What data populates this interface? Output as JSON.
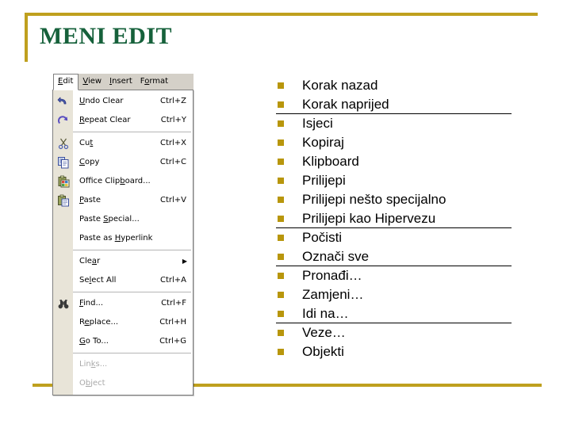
{
  "slide": {
    "title": "MENI EDIT",
    "accent_color": "#bfa01e",
    "title_color": "#16613b",
    "bullet_color": "#b8960c",
    "background_color": "#ffffff"
  },
  "menu_screenshot": {
    "menubar": [
      {
        "label": "Edit",
        "accel_letter": "E",
        "active": true
      },
      {
        "label": "View",
        "accel_letter": "V",
        "active": false
      },
      {
        "label": "Insert",
        "accel_letter": "I",
        "active": false
      },
      {
        "label": "Format",
        "accel_letter": "o",
        "active": false
      }
    ],
    "items": [
      {
        "label": "Undo Clear",
        "accel": "Ctrl+Z",
        "icon": "undo-arrow-icon",
        "disabled": false,
        "submenu": false
      },
      {
        "label": "Repeat Clear",
        "accel": "Ctrl+Y",
        "icon": "redo-arrow-icon",
        "disabled": false,
        "submenu": false
      },
      {
        "separator": true
      },
      {
        "label": "Cut",
        "accel": "Ctrl+X",
        "icon": "scissors-icon",
        "disabled": false,
        "submenu": false
      },
      {
        "label": "Copy",
        "accel": "Ctrl+C",
        "icon": "copy-icon",
        "disabled": false,
        "submenu": false
      },
      {
        "label": "Office Clipboard...",
        "accel": "",
        "icon": "office-clipboard-icon",
        "disabled": false,
        "submenu": false
      },
      {
        "label": "Paste",
        "accel": "Ctrl+V",
        "icon": "paste-icon",
        "disabled": false,
        "submenu": false
      },
      {
        "label": "Paste Special...",
        "accel": "",
        "icon": "",
        "disabled": false,
        "submenu": false
      },
      {
        "label": "Paste as Hyperlink",
        "accel": "",
        "icon": "",
        "disabled": false,
        "submenu": false
      },
      {
        "separator": true
      },
      {
        "label": "Clear",
        "accel": "",
        "icon": "",
        "disabled": false,
        "submenu": true
      },
      {
        "label": "Select All",
        "accel": "Ctrl+A",
        "icon": "",
        "disabled": false,
        "submenu": false
      },
      {
        "separator": true
      },
      {
        "label": "Find...",
        "accel": "Ctrl+F",
        "icon": "binoculars-icon",
        "disabled": false,
        "submenu": false
      },
      {
        "label": "Replace...",
        "accel": "Ctrl+H",
        "icon": "",
        "disabled": false,
        "submenu": false
      },
      {
        "label": "Go To...",
        "accel": "Ctrl+G",
        "icon": "",
        "disabled": false,
        "submenu": false
      },
      {
        "separator": true
      },
      {
        "label": "Links...",
        "accel": "",
        "icon": "",
        "disabled": true,
        "submenu": false
      },
      {
        "label": "Object",
        "accel": "",
        "icon": "",
        "disabled": true,
        "submenu": false
      }
    ],
    "submenu_arrow_glyph": "▶"
  },
  "bullet_list": {
    "items": [
      {
        "label": "Korak nazad",
        "rule_after": false
      },
      {
        "label": "Korak naprijed",
        "rule_after": true
      },
      {
        "label": "Isjeci",
        "rule_after": false
      },
      {
        "label": "Kopiraj",
        "rule_after": false
      },
      {
        "label": "Klipboard",
        "rule_after": false
      },
      {
        "label": "Prilijepi",
        "rule_after": false
      },
      {
        "label": "Prilijepi nešto specijalno",
        "rule_after": false
      },
      {
        "label": "Prilijepi kao Hipervezu",
        "rule_after": true
      },
      {
        "label": "Počisti",
        "rule_after": false
      },
      {
        "label": "Označi sve",
        "rule_after": true
      },
      {
        "label": "Pronađi…",
        "rule_after": false
      },
      {
        "label": "Zamjeni…",
        "rule_after": false
      },
      {
        "label": "Idi na…",
        "rule_after": true
      },
      {
        "label": "Veze…",
        "rule_after": false
      },
      {
        "label": "Objekti",
        "rule_after": false
      }
    ]
  }
}
